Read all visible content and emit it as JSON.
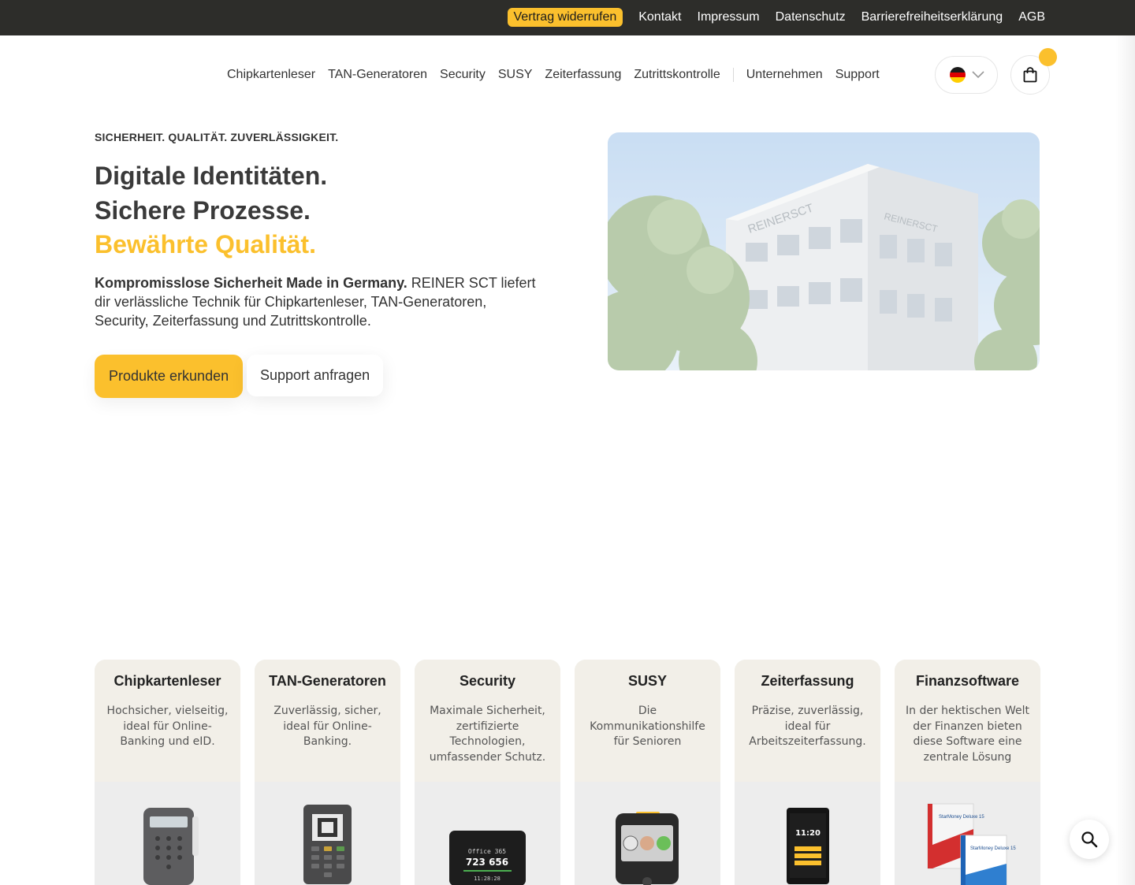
{
  "topbar": {
    "links": [
      {
        "label": "Vertrag widerrufen"
      },
      {
        "label": "Kontakt"
      },
      {
        "label": "Impressum"
      },
      {
        "label": "Datenschutz"
      },
      {
        "label": "Barrierefreiheitserklärung"
      },
      {
        "label": "AGB"
      }
    ]
  },
  "nav": {
    "primary": [
      "Chipkartenleser",
      "TAN-Generatoren",
      "Security",
      "SUSY",
      "Zeiterfassung",
      "Zutrittskontrolle"
    ],
    "secondary": [
      "Unternehmen",
      "Support"
    ],
    "language_icon": "germany-flag-icon",
    "cart_icon": "shopping-bag-icon"
  },
  "hero": {
    "eyebrow": "SICHERHEIT. QUALITÄT. ZUVERLÄSSIGKEIT.",
    "headline_1": "Digitale Identitäten.",
    "headline_2": "Sichere Prozesse.",
    "headline_3": "Bewährte Qualität.",
    "lead_bold": "Kompromisslose Sicherheit Made in Germany.",
    "lead_text": " REINER SCT liefert dir verlässliche Technik für Chipkartenleser, TAN-Generatoren, Security, Zeiterfassung und Zutrittskontrolle.",
    "btn_primary": "Produkte erkunden",
    "btn_secondary": "Support anfragen",
    "image_sign_1": "REINERSCT",
    "image_sign_2": "REINERSCT"
  },
  "cards": [
    {
      "title": "Chipkartenleser",
      "desc": "Hochsicher, vielseitig, ideal für Online-Banking und eID."
    },
    {
      "title": "TAN-Generatoren",
      "desc": "Zuverlässig, sicher, ideal für Online-Banking."
    },
    {
      "title": "Security",
      "desc": "Maximale Sicherheit, zertifizierte Technologien, umfassender Schutz."
    },
    {
      "title": "SUSY",
      "desc": "Die Kommunikationshilfe für Senioren"
    },
    {
      "title": "Zeiterfassung",
      "desc": "Präzise, zuverlässig, ideal für Arbeitszeiterfassung."
    },
    {
      "title": "Finanzsoftware",
      "desc": "In der hektischen Welt der Finanzen bieten diese Software eine zentrale Lösung"
    }
  ],
  "device_texts": {
    "security_line1": "Office 365",
    "security_code": "723 656",
    "security_time": "11:28:28",
    "time_display": "11:20",
    "starmoney_1": "StarMoney Deluxe 15",
    "starmoney_2": "StarMoney Deluxe 15"
  },
  "colors": {
    "accent": "#fbc02d",
    "topbar": "#2d2d2a",
    "card_top": "#f2efe8"
  }
}
